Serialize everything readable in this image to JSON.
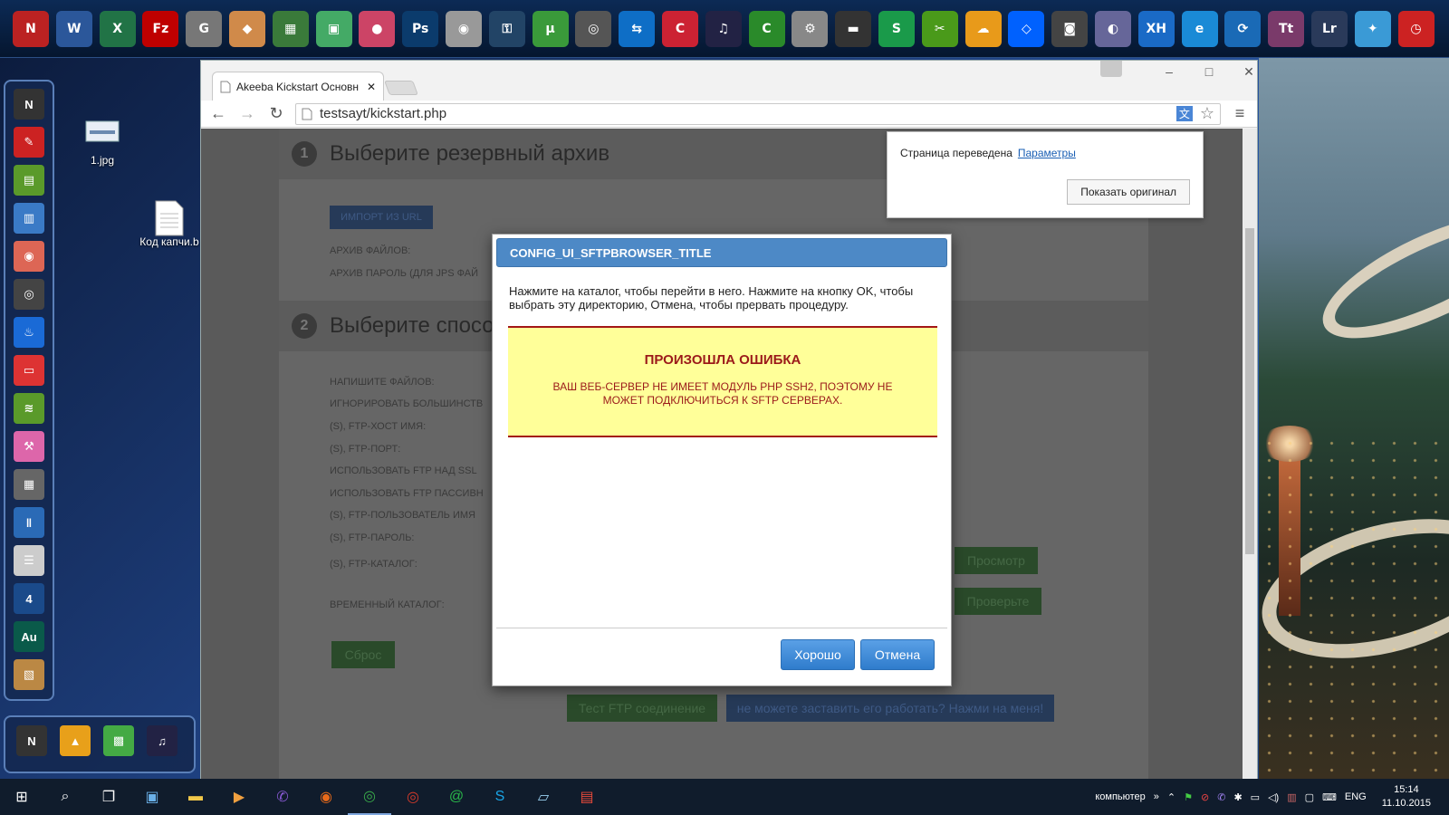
{
  "desktop": {
    "icons": [
      {
        "label": "1.jpg"
      },
      {
        "label": "Код капчи.b"
      }
    ]
  },
  "top_taskbar": {
    "icons": [
      {
        "name": "nexus",
        "text": "N",
        "color": "#b22"
      },
      {
        "name": "word",
        "text": "W",
        "color": "#2b579a"
      },
      {
        "name": "excel",
        "text": "X",
        "color": "#217346"
      },
      {
        "name": "filezilla",
        "text": "Fz",
        "color": "#bf0000"
      },
      {
        "name": "grey",
        "text": "G",
        "color": "#777"
      },
      {
        "name": "paint",
        "text": "◆",
        "color": "#d08a4a"
      },
      {
        "name": "calc",
        "text": "▦",
        "color": "#3a7a3a"
      },
      {
        "name": "photo",
        "text": "▣",
        "color": "#4a6"
      },
      {
        "name": "color",
        "text": "●",
        "color": "#c46"
      },
      {
        "name": "photoshop",
        "text": "Ps",
        "color": "#0b3b6c"
      },
      {
        "name": "disc",
        "text": "◉",
        "color": "#999"
      },
      {
        "name": "lock",
        "text": "⚿",
        "color": "#246"
      },
      {
        "name": "utorrent",
        "text": "µ",
        "color": "#3a9a3a"
      },
      {
        "name": "webcam",
        "text": "◎",
        "color": "#555"
      },
      {
        "name": "teamviewer",
        "text": "⇆",
        "color": "#0e6ec6"
      },
      {
        "name": "ccleaner",
        "text": "C",
        "color": "#c23"
      },
      {
        "name": "headphones",
        "text": "♫",
        "color": "#224"
      },
      {
        "name": "coda",
        "text": "C",
        "color": "#2a8a2a"
      },
      {
        "name": "gears",
        "text": "⚙",
        "color": "#888"
      },
      {
        "name": "chip",
        "text": "▬",
        "color": "#333"
      },
      {
        "name": "skype-s",
        "text": "S",
        "color": "#1a9a4a"
      },
      {
        "name": "mp3cut",
        "text": "✂",
        "color": "#4a9a1a"
      },
      {
        "name": "weather",
        "text": "☁",
        "color": "#e89a1a"
      },
      {
        "name": "dropbox",
        "text": "◇",
        "color": "#0061fe"
      },
      {
        "name": "camera",
        "text": "◙",
        "color": "#444"
      },
      {
        "name": "globe",
        "text": "◐",
        "color": "#669"
      },
      {
        "name": "xh",
        "text": "XH",
        "color": "#1a6ac6"
      },
      {
        "name": "ie",
        "text": "e",
        "color": "#1a8ad6"
      },
      {
        "name": "sync",
        "text": "⟳",
        "color": "#1a6ab6"
      },
      {
        "name": "tt",
        "text": "Tt",
        "color": "#7a3a6a"
      },
      {
        "name": "lightroom",
        "text": "Lr",
        "color": "#2a3a5a"
      },
      {
        "name": "bird",
        "text": "✦",
        "color": "#3a9ad6"
      },
      {
        "name": "clock",
        "text": "◷",
        "color": "#c22"
      }
    ]
  },
  "left_dock": {
    "icons": [
      {
        "name": "nexus",
        "text": "N",
        "color": "#333"
      },
      {
        "name": "feather",
        "text": "✎",
        "color": "#c22"
      },
      {
        "name": "chart",
        "text": "▤",
        "color": "#5a9a2a"
      },
      {
        "name": "picture",
        "text": "▥",
        "color": "#3a7ac6"
      },
      {
        "name": "eye",
        "text": "◉",
        "color": "#d65"
      },
      {
        "name": "eye2",
        "text": "◎",
        "color": "#444"
      },
      {
        "name": "flame",
        "text": "♨",
        "color": "#1a6ad6"
      },
      {
        "name": "card",
        "text": "▭",
        "color": "#d33"
      },
      {
        "name": "wifi",
        "text": "≋",
        "color": "#5a9a2a"
      },
      {
        "name": "tools",
        "text": "⚒",
        "color": "#d6a"
      },
      {
        "name": "server",
        "text": "▦",
        "color": "#666"
      },
      {
        "name": "equalizer",
        "text": "‖",
        "color": "#2a6ab6"
      },
      {
        "name": "notes",
        "text": "☰",
        "color": "#ccc"
      },
      {
        "name": "four",
        "text": "4",
        "color": "#1a4a8a"
      },
      {
        "name": "audition",
        "text": "Au",
        "color": "#0a5a4a"
      },
      {
        "name": "slides",
        "text": "▧",
        "color": "#b84"
      }
    ]
  },
  "bottom_dock": {
    "icons": [
      {
        "name": "nexus",
        "text": "N",
        "color": "#333"
      },
      {
        "name": "triangle",
        "text": "▲",
        "color": "#e8a01a"
      },
      {
        "name": "cube",
        "text": "▩",
        "color": "#4a4"
      },
      {
        "name": "headset",
        "text": "♫",
        "color": "#224"
      }
    ]
  },
  "browser": {
    "tab_title": "Akeeba Kickstart Основн",
    "url": "testsayt/kickstart.php",
    "window_controls": {
      "minimize": "–",
      "maximize": "□",
      "close": "✕"
    }
  },
  "translate_popup": {
    "text": "Страница переведена",
    "link": "Параметры",
    "button": "Показать оригинал"
  },
  "page": {
    "section1": {
      "num": "1",
      "title": "Выберите резервный архив"
    },
    "import_btn": "ИМПОРТ ИЗ URL",
    "labels1": [
      "АРХИВ ФАЙЛОВ:",
      "АРХИВ ПАРОЛЬ (ДЛЯ JPS ФАЙ"
    ],
    "section2": {
      "num": "2",
      "title": "Выберите спосо"
    },
    "labels2": [
      "НАПИШИТЕ ФАЙЛОВ:",
      "ИГНОРИРОВАТЬ БОЛЬШИНСТВ",
      "(S), FTP-ХОСТ ИМЯ:",
      "(S), FTP-ПОРТ:",
      "ИСПОЛЬЗОВАТЬ FTP НАД SSL",
      "ИСПОЛЬЗОВАТЬ FTP ПАССИВН",
      "(S), FTP-ПОЛЬЗОВАТЕЛЬ ИМЯ",
      "(S), FTP-ПАРОЛЬ:",
      "(S), FTP-КАТАЛОГ:",
      "ВРЕМЕННЫЙ КАТАЛОГ:"
    ],
    "browse_btn": "Просмотр",
    "check_btn": "Проверьте",
    "reset_btn": "Сброс",
    "test_ftp_btn": "Тест FTP соединение",
    "help_btn": "не можете заставить его работать? Нажми на меня!"
  },
  "dialog": {
    "title": "CONFIG_UI_SFTPBROWSER_TITLE",
    "message": "Нажмите на каталог, чтобы перейти в него. Нажмите на кнопку OK, чтобы выбрать эту директорию, Отмена, чтобы прервать процедуру.",
    "error_title": "ПРОИЗОШЛА ОШИБКА",
    "error_message": "ВАШ ВЕБ-СЕРВЕР НЕ ИМЕЕТ МОДУЛЬ PHP SSH2, ПОЭТОМУ НЕ МОЖЕТ ПОДКЛЮЧИТЬСЯ К SFTP СЕРВЕРАХ.",
    "ok_button": "Хорошо",
    "cancel_button": "Отмена"
  },
  "taskbar": {
    "tray_label": "компьютер",
    "chevron": "»",
    "language": "ENG",
    "time": "15:14",
    "date": "11.10.2015"
  }
}
